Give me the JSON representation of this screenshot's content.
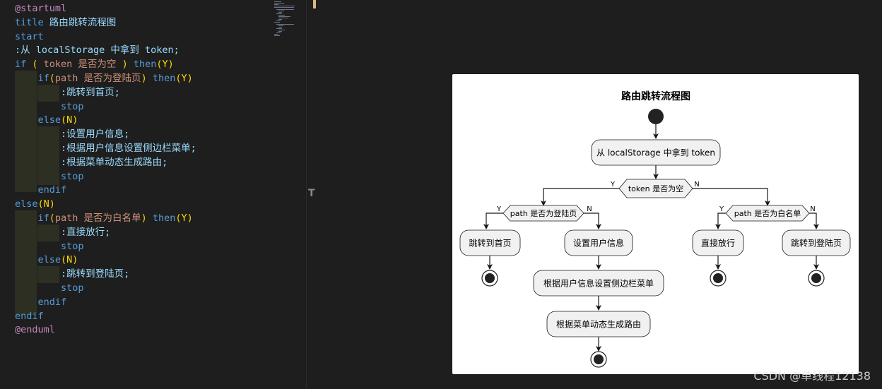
{
  "editor": {
    "lines": [
      [
        {
          "t": "@startuml",
          "c": "at"
        }
      ],
      [
        {
          "t": "title ",
          "c": "kw"
        },
        {
          "t": "路由跳转流程图",
          "c": "text"
        }
      ],
      [
        {
          "t": "start",
          "c": "kw"
        }
      ],
      [
        {
          "t": ":从 localStorage 中拿到 token;",
          "c": "text"
        }
      ],
      [
        {
          "t": "if ",
          "c": "kw"
        },
        {
          "t": "( ",
          "c": "paren"
        },
        {
          "t": "token 是否为空 ",
          "c": "str"
        },
        {
          "t": ") ",
          "c": "paren"
        },
        {
          "t": "then",
          "c": "kw"
        },
        {
          "t": "(Y)",
          "c": "paren"
        }
      ],
      [
        {
          "t": "    "
        },
        {
          "t": "if",
          "c": "kw"
        },
        {
          "t": "(",
          "c": "paren"
        },
        {
          "t": "path 是否为登陆页",
          "c": "str"
        },
        {
          "t": ") ",
          "c": "paren"
        },
        {
          "t": "then",
          "c": "kw"
        },
        {
          "t": "(Y)",
          "c": "paren"
        }
      ],
      [
        {
          "t": "        "
        },
        {
          "t": ":跳转到首页;",
          "c": "text"
        }
      ],
      [
        {
          "t": "        "
        },
        {
          "t": "stop",
          "c": "kw"
        }
      ],
      [
        {
          "t": "    "
        },
        {
          "t": "else",
          "c": "kw"
        },
        {
          "t": "(N)",
          "c": "paren"
        }
      ],
      [
        {
          "t": "        "
        },
        {
          "t": ":设置用户信息;",
          "c": "text"
        }
      ],
      [
        {
          "t": "        "
        },
        {
          "t": ":根据用户信息设置侧边栏菜单;",
          "c": "text"
        }
      ],
      [
        {
          "t": "        "
        },
        {
          "t": ":根据菜单动态生成路由;",
          "c": "text"
        }
      ],
      [
        {
          "t": "        "
        },
        {
          "t": "stop",
          "c": "kw"
        }
      ],
      [
        {
          "t": "    "
        },
        {
          "t": "endif",
          "c": "kw"
        }
      ],
      [
        {
          "t": "else",
          "c": "kw"
        },
        {
          "t": "(N)",
          "c": "paren"
        }
      ],
      [
        {
          "t": "    "
        },
        {
          "t": "if",
          "c": "kw"
        },
        {
          "t": "(",
          "c": "paren"
        },
        {
          "t": "path 是否为白名单",
          "c": "str"
        },
        {
          "t": ") ",
          "c": "paren"
        },
        {
          "t": "then",
          "c": "kw"
        },
        {
          "t": "(Y)",
          "c": "paren"
        }
      ],
      [
        {
          "t": "        "
        },
        {
          "t": ":直接放行;",
          "c": "text"
        }
      ],
      [
        {
          "t": "        "
        },
        {
          "t": "stop",
          "c": "kw"
        }
      ],
      [
        {
          "t": "    "
        },
        {
          "t": "else",
          "c": "kw"
        },
        {
          "t": "(N)",
          "c": "paren"
        }
      ],
      [
        {
          "t": "        "
        },
        {
          "t": ":跳转到登陆页;",
          "c": "text"
        }
      ],
      [
        {
          "t": "        "
        },
        {
          "t": "stop",
          "c": "kw"
        }
      ],
      [
        {
          "t": "    "
        },
        {
          "t": "endif",
          "c": "kw"
        }
      ],
      [
        {
          "t": "endif",
          "c": "kw"
        }
      ],
      [
        {
          "t": "@enduml",
          "c": "at"
        }
      ]
    ]
  },
  "diagram": {
    "title": "路由跳转流程图",
    "get_token": "从 localStorage 中拿到 token",
    "cond_token": "token 是否为空",
    "cond_login": "path 是否为登陆页",
    "cond_whitelist": "path 是否为白名单",
    "yes": "Y",
    "no": "N",
    "to_home": "跳转到首页",
    "set_user": "设置用户信息",
    "set_sidebar": "根据用户信息设置侧边栏菜单",
    "gen_routes": "根据菜单动态生成路由",
    "pass": "直接放行",
    "to_login": "跳转到登陆页"
  },
  "watermark": "CSDN @单线程12138",
  "colors": {
    "editor_bg": "#1e1e1e",
    "keyword": "#569cd6",
    "string": "#ce9178",
    "text": "#9cdcfe",
    "paren": "#ffd700",
    "directive": "#c586c0",
    "node_fill": "#f1f1f1"
  }
}
